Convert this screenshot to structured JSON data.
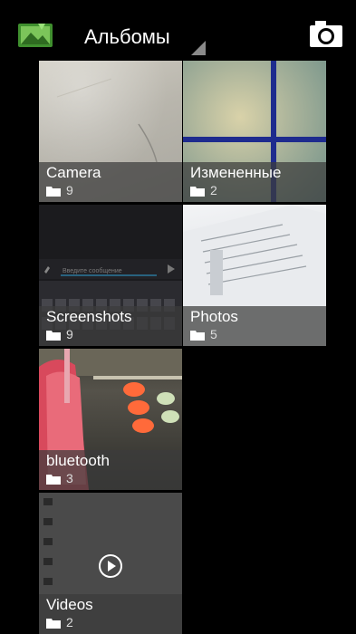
{
  "action_bar": {
    "app_icon": "gallery-icon",
    "spinner_label": "Альбомы",
    "camera_icon": "camera-icon"
  },
  "albums": [
    {
      "name": "Camera",
      "count": "9",
      "icon": "folder-icon"
    },
    {
      "name": "Измененные",
      "count": "2",
      "icon": "folder-icon"
    },
    {
      "name": "Screenshots",
      "count": "9",
      "icon": "folder-icon"
    },
    {
      "name": "Photos",
      "count": "5",
      "icon": "folder-icon"
    },
    {
      "name": "bluetooth",
      "count": "3",
      "icon": "folder-icon"
    },
    {
      "name": "Videos",
      "count": "2",
      "icon": "folder-icon",
      "overlay_icon": "play-icon"
    }
  ],
  "screenshot_thumb": {
    "input_placeholder": "Введите сообщение"
  },
  "colors": {
    "background": "#000000",
    "label_bar": "#3c3c3c",
    "accent_blue": "#1e2b8e"
  }
}
